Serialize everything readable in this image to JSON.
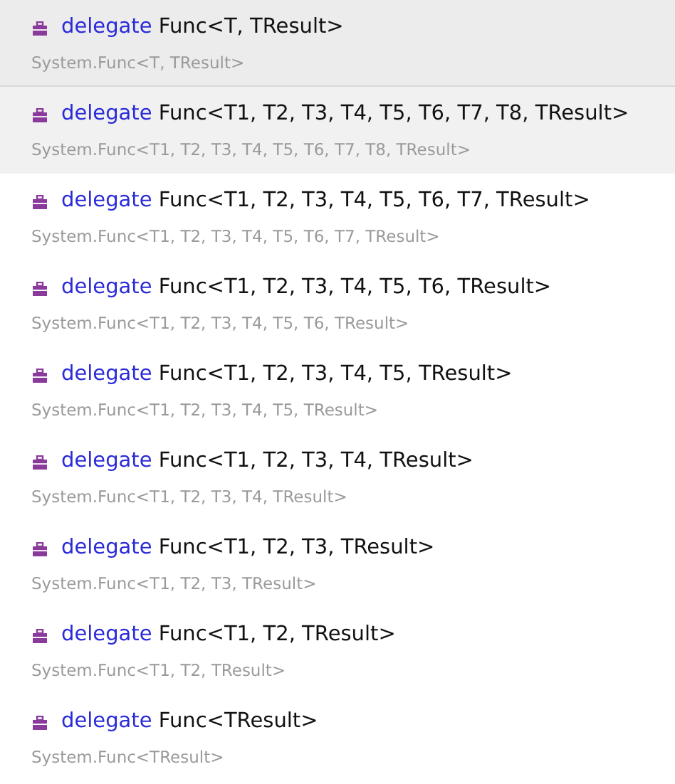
{
  "items": [
    {
      "keyword": "delegate",
      "name": "Func<T, TResult>",
      "full_name": "System.Func<T, TResult>",
      "selected": true,
      "hovered": false
    },
    {
      "keyword": "delegate",
      "name": "Func<T1, T2, T3, T4, T5, T6, T7, T8, TResult>",
      "full_name": "System.Func<T1, T2, T3, T4, T5, T6, T7, T8, TResult>",
      "selected": false,
      "hovered": true
    },
    {
      "keyword": "delegate",
      "name": "Func<T1, T2, T3, T4, T5, T6, T7, TResult>",
      "full_name": "System.Func<T1, T2, T3, T4, T5, T6, T7, TResult>",
      "selected": false,
      "hovered": false
    },
    {
      "keyword": "delegate",
      "name": "Func<T1, T2, T3, T4, T5, T6, TResult>",
      "full_name": "System.Func<T1, T2, T3, T4, T5, T6, TResult>",
      "selected": false,
      "hovered": false
    },
    {
      "keyword": "delegate",
      "name": "Func<T1, T2, T3, T4, T5, TResult>",
      "full_name": "System.Func<T1, T2, T3, T4, T5, TResult>",
      "selected": false,
      "hovered": false
    },
    {
      "keyword": "delegate",
      "name": "Func<T1, T2, T3, T4, TResult>",
      "full_name": "System.Func<T1, T2, T3, T4, TResult>",
      "selected": false,
      "hovered": false
    },
    {
      "keyword": "delegate",
      "name": "Func<T1, T2, T3, TResult>",
      "full_name": "System.Func<T1, T2, T3, TResult>",
      "selected": false,
      "hovered": false
    },
    {
      "keyword": "delegate",
      "name": "Func<T1, T2, TResult>",
      "full_name": "System.Func<T1, T2, TResult>",
      "selected": false,
      "hovered": false
    },
    {
      "keyword": "delegate",
      "name": "Func<TResult>",
      "full_name": "System.Func<TResult>",
      "selected": false,
      "hovered": false
    }
  ]
}
